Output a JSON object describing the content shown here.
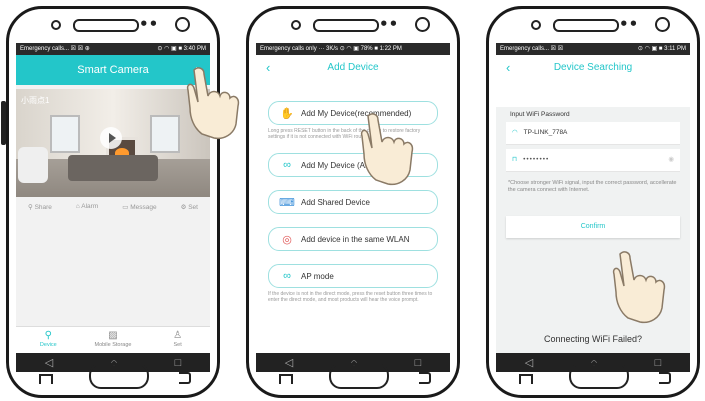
{
  "phones": [
    {
      "status_left": "Emergency calls... ☒ ☒ ⊕",
      "status_right": "⊙ ◠ ▣ ■ 3:40 PM",
      "title": "Smart Camera",
      "camera_name": "小雨点1",
      "actions": [
        "Share",
        "Alarm",
        "Message",
        "Set"
      ],
      "tabs": [
        "Device",
        "Mobile Storage",
        "Set"
      ]
    },
    {
      "status_left": "Emergency calls only ··· 3K/s ⊙ ◠ ▣ 78% ■ 1:22 PM",
      "title": "Add Device",
      "add_recommended": "Add My Device(recommended)",
      "note_recommended": "Long press RESET button in the back of the device to restore factory settings if it is not connected with WiFi router",
      "add_ap": "Add My Device (AP mode)",
      "add_shared": "Add Shared Device",
      "add_wlan": "Add device in the same WLAN",
      "ap_mode": "AP mode",
      "note_ap": "If the device is not in the direct mode, press the reset button three times to enter the direct mode, and most products will hear the voice prompt."
    },
    {
      "status_left": "Emergency calls... ☒ ☒",
      "status_right": "⊙ ◠ ▣ ■ 3:11 PM",
      "title": "Device Searching",
      "password_label": "Input WiFi Password",
      "wifi_name": "TP-LINK_778A",
      "password_mask": "••••••••",
      "note": "*Choose stronger WiFi signal, input the correct password, accellerate the camera connect with Internet.",
      "confirm": "Confirm",
      "failed": "Connecting WiFi Failed?"
    }
  ],
  "navbar": {
    "back": "◁",
    "home": "○",
    "recent": "□"
  },
  "accent_color": "#23c6c9"
}
